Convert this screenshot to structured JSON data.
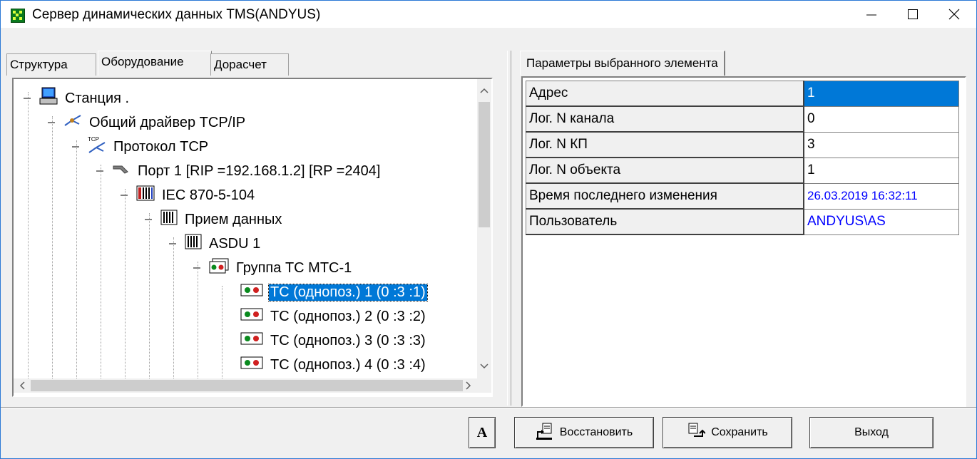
{
  "window": {
    "title": "Сервер динамических данных TMS(ANDYUS)",
    "minimize": "—",
    "maximize": "☐",
    "close": "✕"
  },
  "left_tabs": [
    {
      "label": "Структура"
    },
    {
      "label": "Оборудование",
      "active": true
    },
    {
      "label": "Дорасчет"
    }
  ],
  "tree": [
    {
      "label": "Станция .",
      "icon": "computer-icon"
    },
    {
      "label": "Общий драйвер TCP/IP",
      "icon": "network-driver-icon"
    },
    {
      "label": "Протокол TCP",
      "icon": "tcp-protocol-icon"
    },
    {
      "label": "Порт  1 [RIP =192.168.1.2] [RP =2404]",
      "icon": "port-icon"
    },
    {
      "label": "IEC 870-5-104",
      "icon": "iec-device-icon"
    },
    {
      "label": "Прием данных",
      "icon": "data-receive-icon"
    },
    {
      "label": "ASDU 1",
      "icon": "asdu-icon"
    },
    {
      "label": "Группа ТС МТС-1",
      "icon": "signal-group-icon"
    },
    {
      "label": "ТС (однопоз.)  1 (0 :3 :1)",
      "icon": "signal-icon",
      "selected": true
    },
    {
      "label": "ТС (однопоз.)  2 (0 :3 :2)",
      "icon": "signal-icon"
    },
    {
      "label": "ТС (однопоз.)  3 (0 :3 :3)",
      "icon": "signal-icon"
    },
    {
      "label": "ТС (однопоз.)  4 (0 :3 :4)",
      "icon": "signal-icon"
    }
  ],
  "right_tab": {
    "label": "Параметры выбранного элемента"
  },
  "params": [
    {
      "key": "Адрес",
      "value": "1"
    },
    {
      "key": "Лог. N канала",
      "value": "0"
    },
    {
      "key": "Лог. N КП",
      "value": "3"
    },
    {
      "key": "Лог. N объекта",
      "value": "1"
    },
    {
      "key": "Время последнего изменения",
      "value": "26.03.2019 16:32:11"
    },
    {
      "key": "Пользователь",
      "value": "ANDYUS\\AS"
    }
  ],
  "buttons": {
    "font": "A",
    "restore": "Восстановить",
    "save": "Сохранить",
    "exit": "Выход"
  },
  "colors": {
    "selection": "#0078d7",
    "value_blue": "#0000ff",
    "app_icon": "#0a7a1e"
  }
}
